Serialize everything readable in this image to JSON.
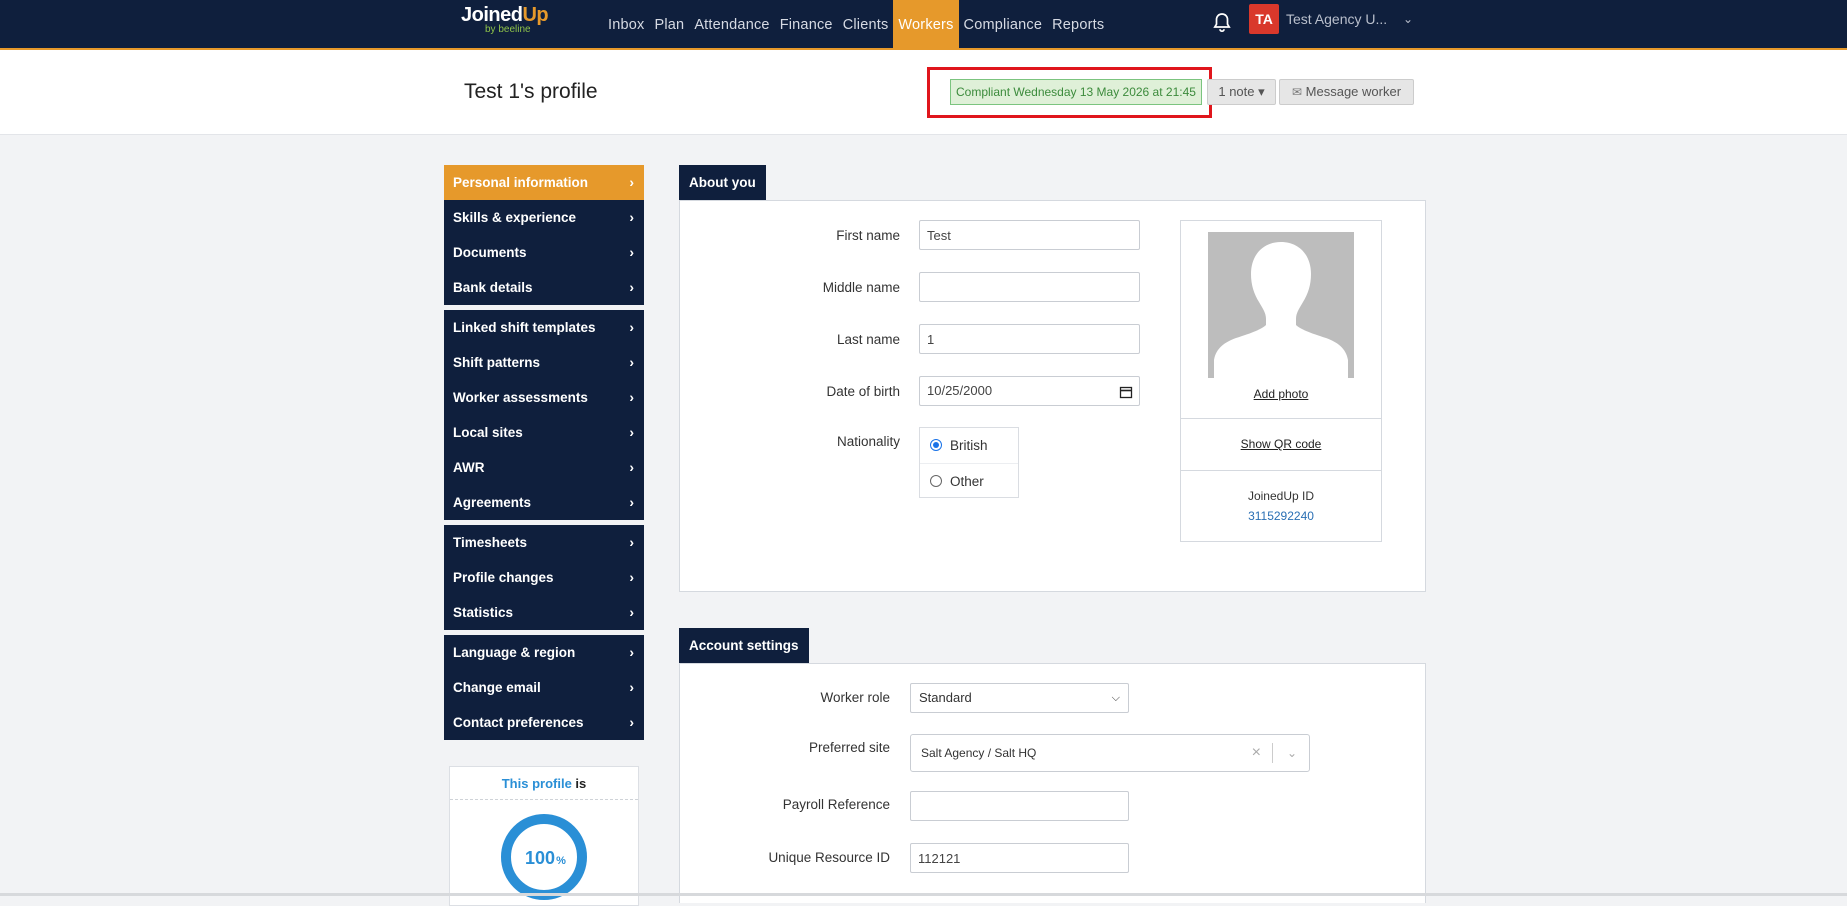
{
  "nav": {
    "logo_main": "Joined",
    "logo_up": "Up",
    "logo_sub": "by beeline",
    "items": [
      {
        "label": "Inbox"
      },
      {
        "label": "Plan"
      },
      {
        "label": "Attendance"
      },
      {
        "label": "Finance"
      },
      {
        "label": "Clients"
      },
      {
        "label": "Workers",
        "active": true
      },
      {
        "label": "Compliance"
      },
      {
        "label": "Reports"
      }
    ],
    "avatar_initials": "TA",
    "user_name": "Test Agency U..."
  },
  "header": {
    "title": "Test 1's profile",
    "compliance": "Compliant Wednesday 13 May 2026 at 21:45",
    "notes_label": "1 note ▾",
    "message_label": "Message worker"
  },
  "sidebar": {
    "groups": [
      [
        {
          "label": "Personal information",
          "active": true
        },
        {
          "label": "Skills & experience"
        },
        {
          "label": "Documents"
        },
        {
          "label": "Bank details"
        }
      ],
      [
        {
          "label": "Linked shift templates"
        },
        {
          "label": "Shift patterns"
        },
        {
          "label": "Worker assessments"
        },
        {
          "label": "Local sites"
        },
        {
          "label": "AWR"
        },
        {
          "label": "Agreements"
        }
      ],
      [
        {
          "label": "Timesheets"
        },
        {
          "label": "Profile changes"
        },
        {
          "label": "Statistics"
        }
      ],
      [
        {
          "label": "Language & region"
        },
        {
          "label": "Change email"
        },
        {
          "label": "Contact preferences"
        }
      ]
    ],
    "profile_box": {
      "prefix": "This profile",
      "suffix": "is",
      "percent": "100",
      "percent_sign": "%",
      "completion": 1.0
    }
  },
  "about": {
    "tab": "About you",
    "first_name_label": "First name",
    "first_name": "Test",
    "middle_name_label": "Middle name",
    "middle_name": "",
    "last_name_label": "Last name",
    "last_name": "1",
    "dob_label": "Date of birth",
    "dob": "10/25/2000",
    "nationality_label": "Nationality",
    "nationality_options": [
      "British",
      "Other"
    ],
    "nationality_selected": "British",
    "add_photo": "Add photo",
    "show_qr": "Show QR code",
    "id_label": "JoinedUp ID",
    "id_value": "3115292240"
  },
  "account": {
    "tab": "Account settings",
    "role_label": "Worker role",
    "role_value": "Standard",
    "site_label": "Preferred site",
    "site_value": "Salt Agency / Salt HQ",
    "payroll_label": "Payroll Reference",
    "payroll_value": "",
    "uri_label": "Unique Resource ID",
    "uri_value": "112121"
  },
  "colors": {
    "navy": "#0f1f3d",
    "accent": "#e6992b",
    "compliant_green": "#3c8b3c",
    "highlight_red": "#e0161c",
    "link_blue": "#2a8fd6"
  }
}
